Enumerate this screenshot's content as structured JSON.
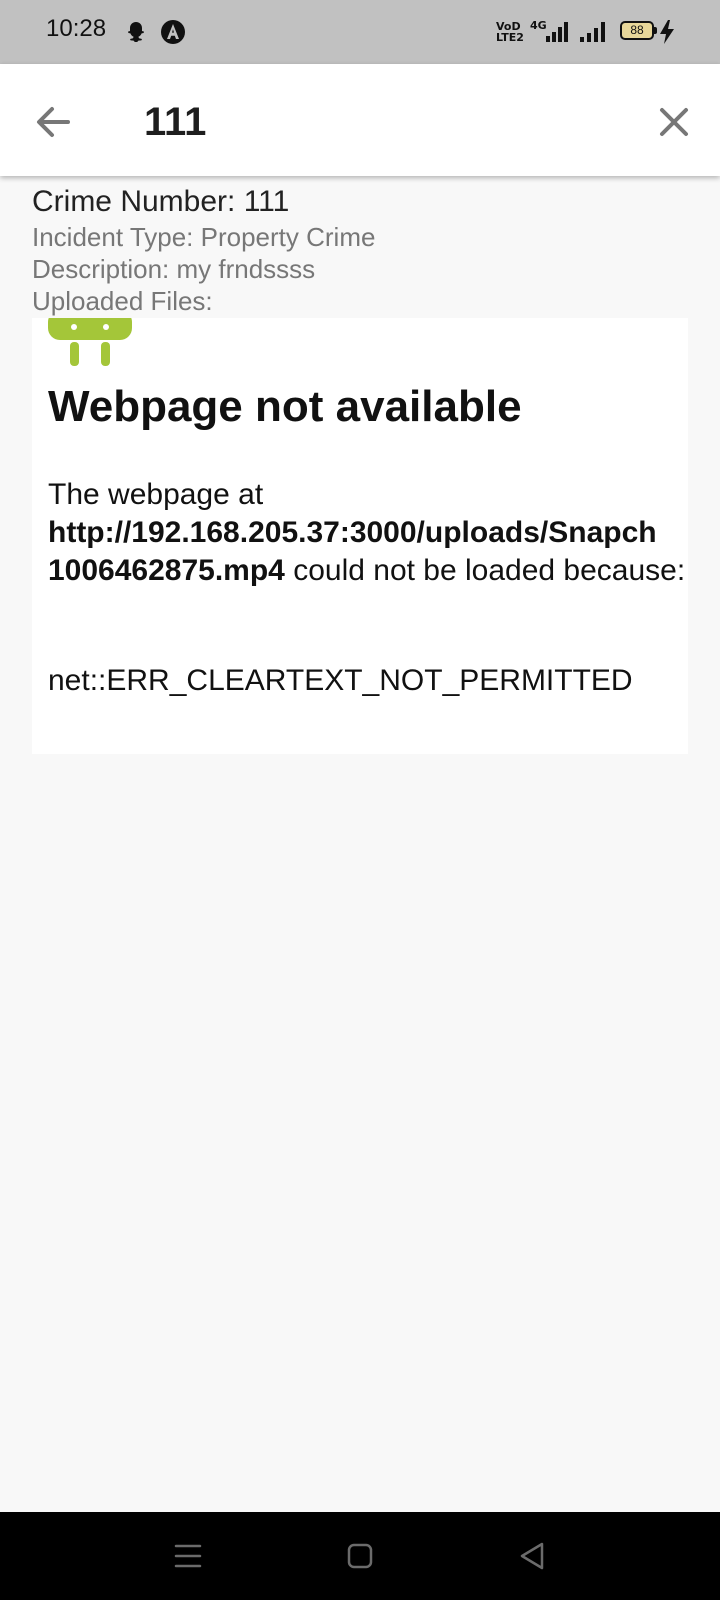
{
  "status_bar": {
    "time": "10:28",
    "notification_icons": [
      "snapchat-icon",
      "app-a-icon"
    ],
    "network_label_1": "VoD LTE2",
    "network_label_2": "4G",
    "battery_level": "88"
  },
  "app_bar": {
    "back_icon": "arrow-left-icon",
    "query": "111",
    "clear_icon": "close-icon"
  },
  "crime": {
    "number_line": "Crime Number: 111",
    "incident_line": "Incident Type: Property Crime",
    "description_line": "Description: my frndssss",
    "uploaded_label": "Uploaded Files:"
  },
  "webview": {
    "title": "Webpage not available",
    "intro": "The webpage at",
    "url_part1": "http://192.168.205.37:3000/uploads/Snapch",
    "url_part2": "1006462875.mp4",
    "tail": " could not be loaded because:",
    "error": "net::ERR_CLEARTEXT_NOT_PERMITTED"
  },
  "nav_bar": {
    "buttons": [
      "menu-icon",
      "home-icon",
      "back-triangle-icon"
    ]
  },
  "colors": {
    "status_bar_bg": "#c1c1c1",
    "page_bg": "#f8f8f8",
    "android_green": "#a4c639"
  }
}
